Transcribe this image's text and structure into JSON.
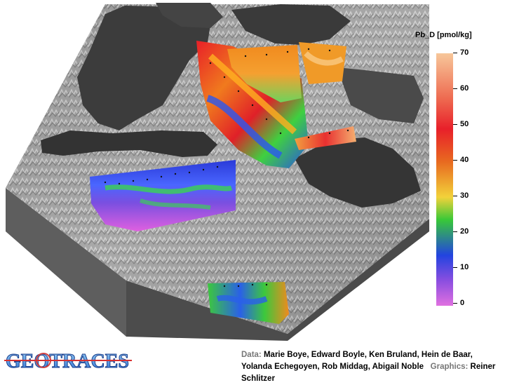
{
  "legend": {
    "title": "Pb_D [pmol/kg]",
    "ticks": [
      "70",
      "60",
      "50",
      "40",
      "30",
      "20",
      "10",
      "0"
    ]
  },
  "logo": {
    "text": "GEOTRACES"
  },
  "credits": {
    "data_label": "Data:",
    "data_text": "Marie Boye, Edward Boyle, Ken Bruland, Hein de Baar, Yolanda Echegoyen, Rob Middag, Abigail Noble",
    "graphics_label": "Graphics:",
    "graphics_text": "Reiner Schlitzer"
  },
  "colors": {
    "max": "#f7c79a",
    "red": "#e8202a",
    "orange": "#f39a1e",
    "green": "#38c838",
    "blue": "#2244e0",
    "min": "#e070e0"
  }
}
